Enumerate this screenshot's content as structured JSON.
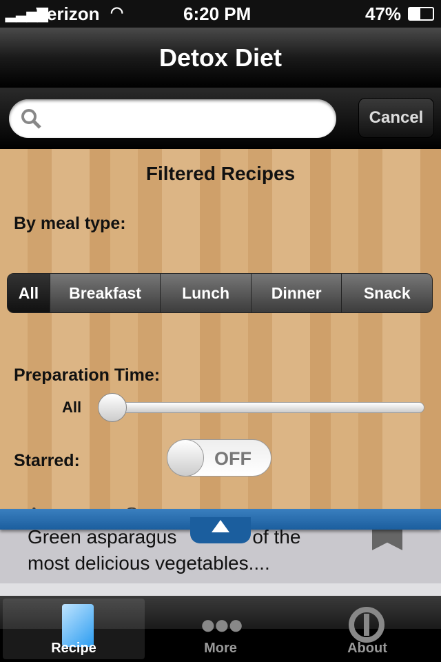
{
  "status": {
    "carrier": "Verizon",
    "time": "6:20 PM",
    "battery": "47%",
    "battery_level": 0.47
  },
  "nav": {
    "title": "Detox Diet"
  },
  "search": {
    "value": "",
    "placeholder": "",
    "cancel": "Cancel"
  },
  "filter": {
    "title": "Filtered Recipes",
    "meal_label": "By meal type:",
    "meal_types": [
      "All",
      "Breakfast",
      "Lunch",
      "Dinner",
      "Snack"
    ],
    "selected_meal": "All",
    "prep_label": "Preparation Time:",
    "prep_value": "All",
    "prep_slider": 0,
    "starred_label": "Starred:",
    "starred_state": "OFF"
  },
  "recipe": {
    "title": "Asparagus Soup",
    "description": "Green asparagus is one of the most delicious vegetables....",
    "visible_desc_1": "Green asparagus",
    "visible_desc_2": "of the",
    "visible_desc_3": "most delicious vegetables...."
  },
  "tabs": [
    {
      "label": "Recipe",
      "icon": "recipe-book-icon"
    },
    {
      "label": "More",
      "icon": "more-dots-icon"
    },
    {
      "label": "About",
      "icon": "about-info-icon"
    }
  ]
}
